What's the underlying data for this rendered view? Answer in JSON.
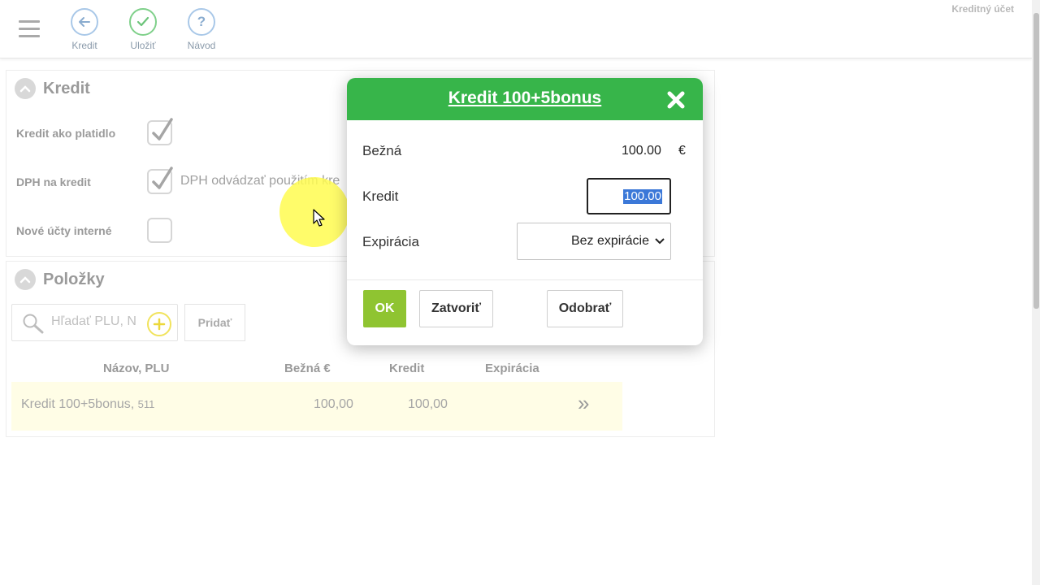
{
  "toolbar": {
    "buttons": [
      {
        "label": "Kredit",
        "icon": "back-arrow-icon"
      },
      {
        "label": "Uložiť",
        "icon": "checkmark-icon"
      },
      {
        "label": "Návod",
        "icon": "question-icon"
      }
    ],
    "account_title": "Kreditný účet"
  },
  "kredit_panel": {
    "title": "Kredit",
    "rows": [
      {
        "label": "Kredit ako platidlo",
        "checked": true
      },
      {
        "label": "DPH na kredit",
        "checked": true,
        "note": "DPH odvádzať použitím kre"
      },
      {
        "label": "Nové účty interné",
        "checked": false
      }
    ]
  },
  "items_panel": {
    "title": "Položky",
    "search_placeholder": "Hľadať PLU, N",
    "add_label": "Pridať",
    "columns": [
      "Názov, PLU",
      "Bežná €",
      "Kredit",
      "Expirácia"
    ],
    "rows": [
      {
        "name": "Kredit 100+5bonus,",
        "plu": "511",
        "normal": "100,00",
        "credit": "100,00",
        "expiration": "",
        "action": "»"
      }
    ]
  },
  "modal": {
    "title": "Kredit 100+5bonus",
    "normal_label": "Bežná",
    "normal_value": "100.00",
    "currency": "€",
    "credit_label": "Kredit",
    "credit_value": "100.00",
    "expiration_label": "Expirácia",
    "expiration_value": "Bez expirácie",
    "ok_label": "OK",
    "close_label": "Zatvoriť",
    "remove_label": "Odobrať"
  },
  "colors": {
    "modal_header": "#37b54a",
    "ok_button": "#8fc431",
    "row_highlight": "#fffde6",
    "cursor_highlight": "#fffc50"
  }
}
